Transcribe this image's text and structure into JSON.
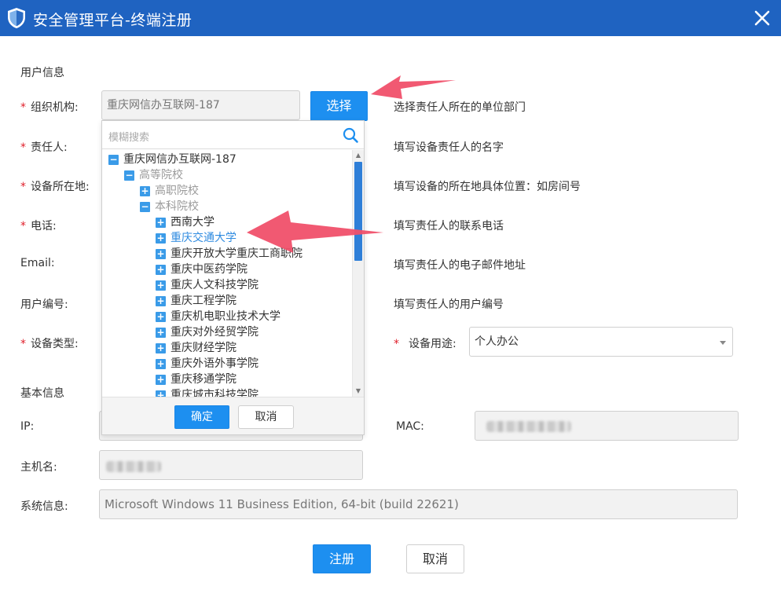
{
  "window": {
    "title": "安全管理平台-终端注册"
  },
  "sections": {
    "user_info": "用户信息",
    "basic_info": "基本信息"
  },
  "fields": {
    "org": {
      "label": "组织机构:",
      "value": "重庆网信办互联网-187",
      "hint": "选择责任人所在的单位部门",
      "button": "选择"
    },
    "owner": {
      "label": "责任人:",
      "hint": "填写设备责任人的名字"
    },
    "location": {
      "label": "设备所在地:",
      "hint": "填写设备的所在地具体位置：如房间号"
    },
    "phone": {
      "label": "电话:",
      "hint": "填写责任人的联系电话"
    },
    "email": {
      "label": "Email:",
      "hint": "填写责任人的电子邮件地址"
    },
    "user_no": {
      "label": "用户编号:",
      "hint": "填写责任人的用户编号"
    },
    "device_type": {
      "label": "设备类型:"
    },
    "device_use": {
      "label": "设备用途:",
      "value": "个人办公"
    },
    "ip": {
      "label": "IP:"
    },
    "mac": {
      "label": "MAC:"
    },
    "hostname": {
      "label": "主机名:"
    },
    "sysinfo": {
      "label": "系统信息:",
      "value": "Microsoft Windows 11 Business Edition, 64-bit (build 22621)"
    }
  },
  "required_mark": "*",
  "tree_panel": {
    "search_placeholder": "模糊搜索",
    "nodes": [
      {
        "label": "重庆网信办互联网-187",
        "toggle": "−",
        "level": 0,
        "muted": false,
        "selected": false
      },
      {
        "label": "高等院校",
        "toggle": "−",
        "level": 1,
        "muted": true,
        "selected": false
      },
      {
        "label": "高职院校",
        "toggle": "+",
        "level": 2,
        "muted": true,
        "selected": false
      },
      {
        "label": "本科院校",
        "toggle": "−",
        "level": 2,
        "muted": true,
        "selected": false
      },
      {
        "label": "西南大学",
        "toggle": "+",
        "level": 3,
        "muted": false,
        "selected": false
      },
      {
        "label": "重庆交通大学",
        "toggle": "+",
        "level": 3,
        "muted": false,
        "selected": true
      },
      {
        "label": "重庆开放大学重庆工商职院",
        "toggle": "+",
        "level": 3,
        "muted": false,
        "selected": false
      },
      {
        "label": "重庆中医药学院",
        "toggle": "+",
        "level": 3,
        "muted": false,
        "selected": false
      },
      {
        "label": "重庆人文科技学院",
        "toggle": "+",
        "level": 3,
        "muted": false,
        "selected": false
      },
      {
        "label": "重庆工程学院",
        "toggle": "+",
        "level": 3,
        "muted": false,
        "selected": false
      },
      {
        "label": "重庆机电职业技术大学",
        "toggle": "+",
        "level": 3,
        "muted": false,
        "selected": false
      },
      {
        "label": "重庆对外经贸学院",
        "toggle": "+",
        "level": 3,
        "muted": false,
        "selected": false
      },
      {
        "label": "重庆财经学院",
        "toggle": "+",
        "level": 3,
        "muted": false,
        "selected": false
      },
      {
        "label": "重庆外语外事学院",
        "toggle": "+",
        "level": 3,
        "muted": false,
        "selected": false
      },
      {
        "label": "重庆移通学院",
        "toggle": "+",
        "level": 3,
        "muted": false,
        "selected": false
      },
      {
        "label": "重庆城市科技学院",
        "toggle": "+",
        "level": 3,
        "muted": false,
        "selected": false
      }
    ],
    "confirm": "确定",
    "cancel": "取消"
  },
  "footer": {
    "register": "注册",
    "cancel": "取消"
  },
  "colors": {
    "titlebar": "#1f63c1",
    "primary": "#1d8ff0",
    "required": "#e0202b",
    "selected_node": "#2f8be0",
    "muted_node": "#9a9a9a",
    "arrow": "#f0506a"
  },
  "icons": {
    "title": "shield-icon",
    "close": "close-icon",
    "search": "search-icon"
  }
}
